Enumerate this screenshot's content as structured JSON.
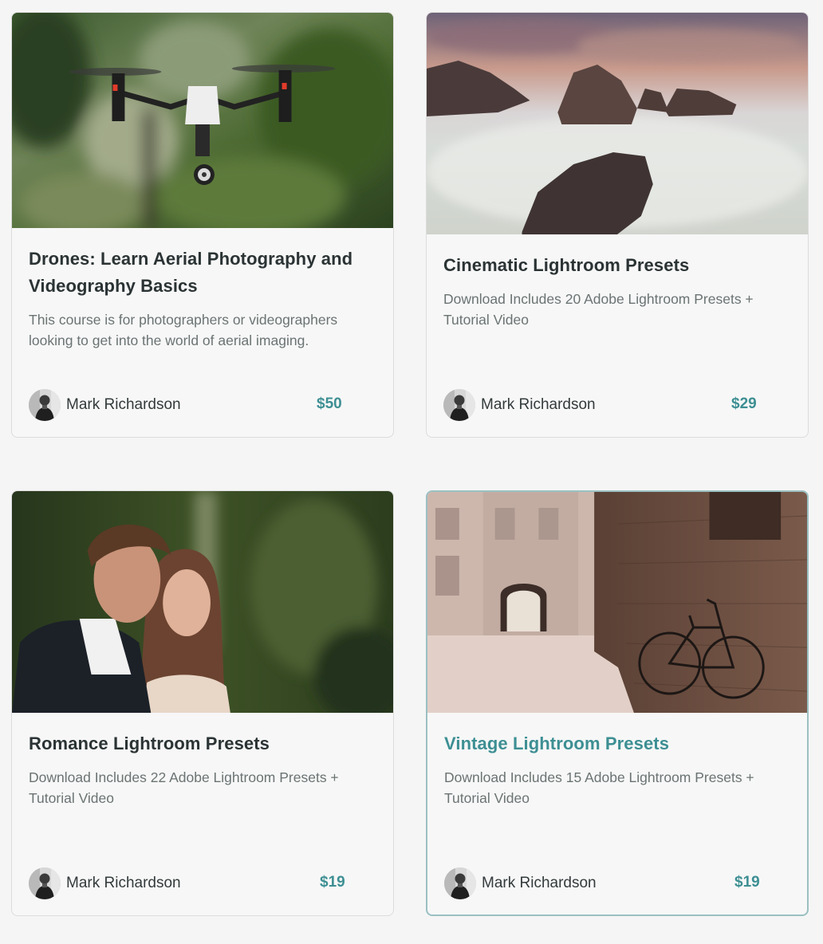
{
  "accent_color": "#3d8f93",
  "cards": [
    {
      "title": "Drones: Learn Aerial Photography and Videography Basics",
      "description": "This course is for photographers or videographers looking to get into the world of aerial imaging.",
      "author": "Mark Richardson",
      "price": "$50",
      "image": "drone-photo"
    },
    {
      "title": "Cinematic Lightroom Presets",
      "description": "Download Includes 20 Adobe Lightroom Presets + Tutorial Video",
      "author": "Mark Richardson",
      "price": "$29",
      "image": "seascape-rocks-photo"
    },
    {
      "title": "Romance Lightroom Presets",
      "description": "Download Includes 22 Adobe Lightroom Presets + Tutorial Video",
      "author": "Mark Richardson",
      "price": "$19",
      "image": "couple-portrait-photo"
    },
    {
      "title": "Vintage Lightroom Presets",
      "description": "Download Includes 15 Adobe Lightroom Presets + Tutorial Video",
      "author": "Mark Richardson",
      "price": "$19",
      "image": "vintage-bicycle-photo"
    }
  ]
}
